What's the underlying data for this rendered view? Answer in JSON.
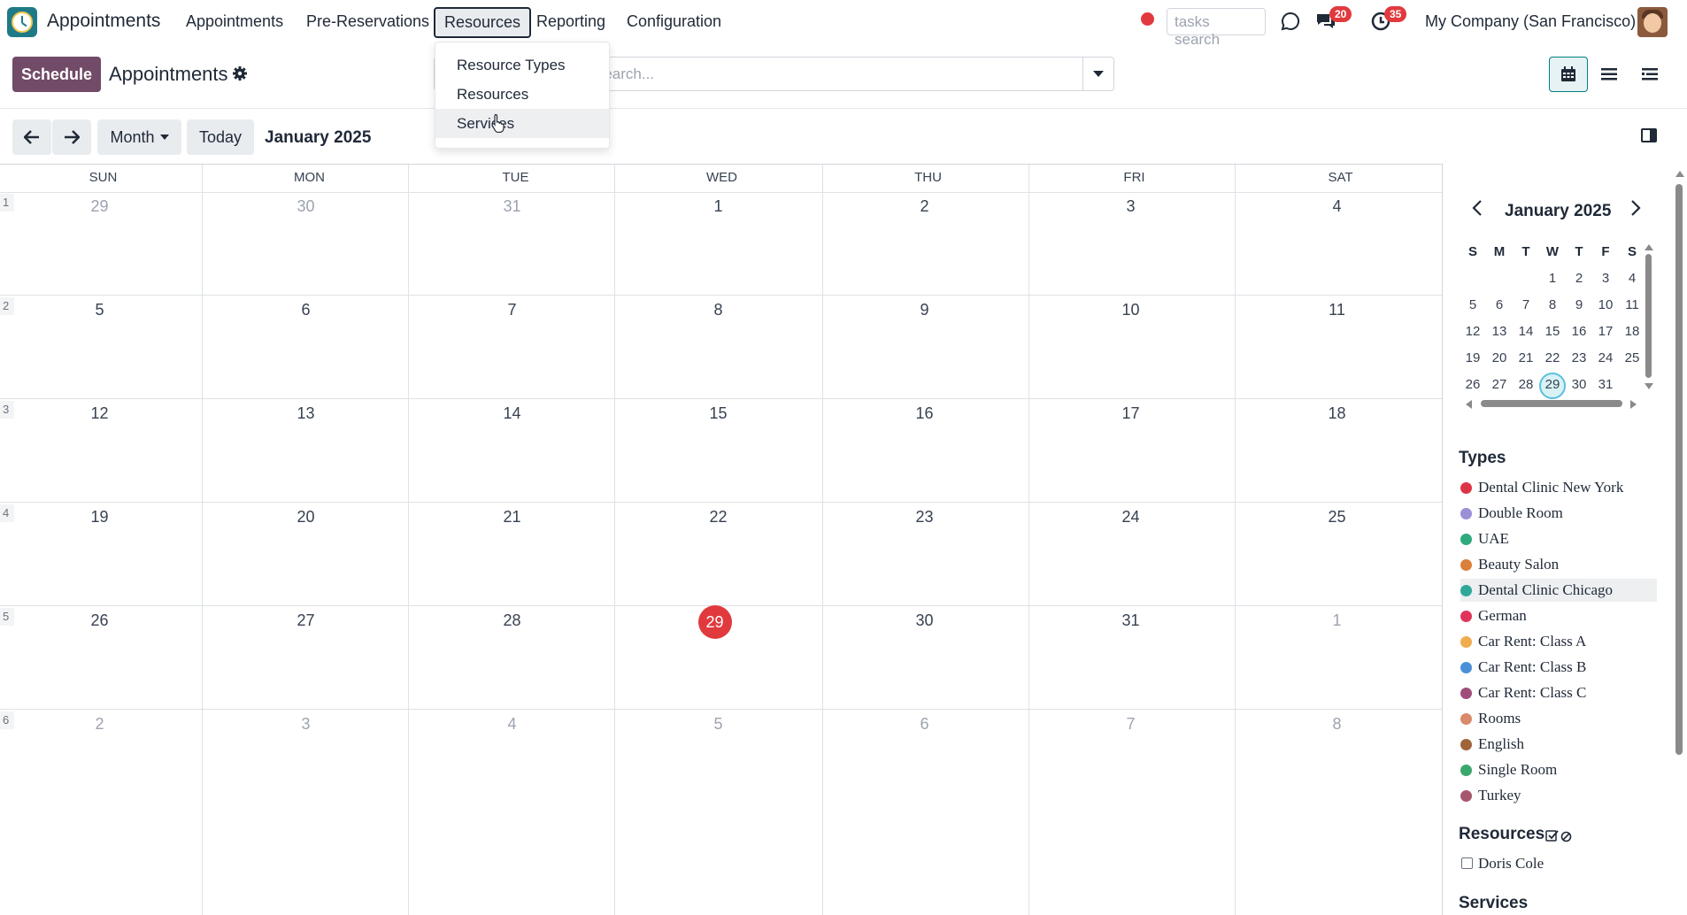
{
  "app": {
    "name": "Appointments"
  },
  "nav": {
    "items": [
      "Appointments",
      "Pre-Reservations",
      "Resources",
      "Reporting",
      "Configuration"
    ],
    "active": "Resources"
  },
  "systray": {
    "search_placeholder": "tasks search",
    "messages_badge": "20",
    "activities_badge": "35",
    "company": "My Company (San Francisco)",
    "recording_color": "#e03a3e"
  },
  "control": {
    "schedule_label": "Schedule",
    "breadcrumb": "Appointments",
    "search_placeholder": "Search...",
    "views": [
      "calendar-view-icon",
      "list-view-icon",
      "gantt-view-icon"
    ]
  },
  "toolbar": {
    "scale_label": "Month",
    "today_label": "Today",
    "period": "January 2025"
  },
  "dropdown": {
    "items": [
      "Resource Types",
      "Resources",
      "Services"
    ],
    "hovered": "Services"
  },
  "calendar": {
    "day_headers": [
      "SUN",
      "MON",
      "TUE",
      "WED",
      "THU",
      "FRI",
      "SAT"
    ],
    "week_numbers": [
      "1",
      "2",
      "3",
      "4",
      "5",
      "6"
    ],
    "weeks": [
      [
        "29",
        "30",
        "31",
        "1",
        "2",
        "3",
        "4"
      ],
      [
        "5",
        "6",
        "7",
        "8",
        "9",
        "10",
        "11"
      ],
      [
        "12",
        "13",
        "14",
        "15",
        "16",
        "17",
        "18"
      ],
      [
        "19",
        "20",
        "21",
        "22",
        "23",
        "24",
        "25"
      ],
      [
        "26",
        "27",
        "28",
        "29",
        "30",
        "31",
        "1"
      ],
      [
        "2",
        "3",
        "4",
        "5",
        "6",
        "7",
        "8"
      ]
    ],
    "today": "29",
    "today_color": "#e03a3e"
  },
  "mini_calendar": {
    "title": "January 2025",
    "dow": [
      "S",
      "M",
      "T",
      "W",
      "T",
      "F",
      "S"
    ],
    "weeks": [
      [
        "",
        "",
        "",
        "1",
        "2",
        "3",
        "4"
      ],
      [
        "5",
        "6",
        "7",
        "8",
        "9",
        "10",
        "11"
      ],
      [
        "12",
        "13",
        "14",
        "15",
        "16",
        "17",
        "18"
      ],
      [
        "19",
        "20",
        "21",
        "22",
        "23",
        "24",
        "25"
      ],
      [
        "26",
        "27",
        "28",
        "29",
        "30",
        "31",
        ""
      ]
    ],
    "selected": "29"
  },
  "filters": {
    "types_title": "Types",
    "types": [
      {
        "label": "Dental Clinic New York",
        "color": "#dc3545"
      },
      {
        "label": "Double Room",
        "color": "#9c8fd6"
      },
      {
        "label": "UAE",
        "color": "#2faa7e"
      },
      {
        "label": "Beauty Salon",
        "color": "#d9803a"
      },
      {
        "label": "Dental Clinic Chicago",
        "color": "#2fa89a"
      },
      {
        "label": "German",
        "color": "#e0355a"
      },
      {
        "label": "Car Rent: Class A",
        "color": "#f0ad4e"
      },
      {
        "label": "Car Rent: Class B",
        "color": "#4a90d9"
      },
      {
        "label": "Car Rent: Class C",
        "color": "#a14d7b"
      },
      {
        "label": "Rooms",
        "color": "#d88a6a"
      },
      {
        "label": "English",
        "color": "#a0643a"
      },
      {
        "label": "Single Room",
        "color": "#3aa86b"
      },
      {
        "label": "Turkey",
        "color": "#a6576e"
      }
    ],
    "types_hovered": "Dental Clinic Chicago",
    "resources_title": "Resources",
    "resources": [
      "Doris Cole"
    ],
    "services_title": "Services"
  }
}
